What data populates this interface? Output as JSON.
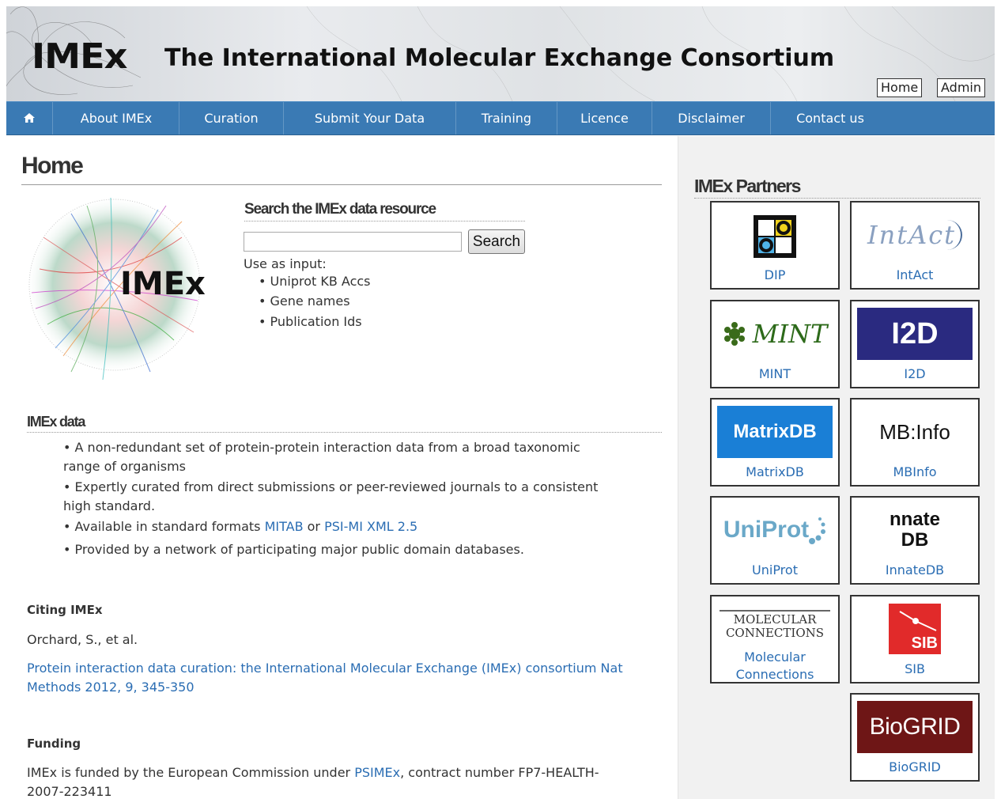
{
  "header": {
    "logo_text": "IMEx",
    "title": "The International Molecular Exchange Consortium",
    "home_button": "Home",
    "admin_button": "Admin"
  },
  "nav": {
    "home_icon": "home-icon",
    "items": [
      "About IMEx",
      "Curation",
      "Submit Your Data",
      "Training",
      "Licence",
      "Disclaimer",
      "Contact us"
    ]
  },
  "main": {
    "page_title": "Home",
    "hero_logo_text": "IMEx",
    "search": {
      "title": "Search the IMEx data resource",
      "placeholder": "",
      "button": "Search",
      "use_as": "Use as input:",
      "inputs": [
        "• Uniprot KB Accs",
        "• Gene names",
        "• Publication Ids"
      ]
    },
    "imex_data": {
      "heading": "IMEx data",
      "bullet1": "• A non-redundant set of protein-protein interaction data from a broad taxonomic range of organisms",
      "bullet2": "• Expertly curated from direct submissions or peer-reviewed journals to a consistent high standard.",
      "bullet3_prefix": "• Available in standard formats ",
      "bullet3_link1": "MITAB",
      "bullet3_mid": " or ",
      "bullet3_link2": "PSI-MI XML 2.5",
      "bullet4": "• Provided by a network of participating major public domain databases."
    },
    "citing": {
      "heading": "Citing IMEx",
      "authors": "Orchard, S., et al.",
      "link": "Protein interaction data curation: the International Molecular Exchange (IMEx) consortium Nat Methods 2012, 9, 345-350"
    },
    "funding": {
      "heading": "Funding",
      "text_prefix": "IMEx is funded by the European Commission under ",
      "link": "PSIMEx",
      "text_suffix": ", contract number FP7-HEALTH-2007-223411"
    }
  },
  "sidebar": {
    "title": "IMEx Partners",
    "partners": [
      {
        "label": "DIP"
      },
      {
        "label": "IntAct",
        "logo_text": "IntAct"
      },
      {
        "label": "MINT",
        "logo_text": "MINT"
      },
      {
        "label": "I2D",
        "logo_text": "I2D"
      },
      {
        "label": "MatrixDB",
        "logo_text": "MatrixDB"
      },
      {
        "label": "MBInfo",
        "logo_text": "MB:Info"
      },
      {
        "label": "UniProt",
        "logo_text": "UniProt"
      },
      {
        "label": "InnateDB",
        "logo_text": "nnate DB"
      },
      {
        "label": "Molecular Connections",
        "logo_text": "MOLECULAR CONNECTIONS"
      },
      {
        "label": "SIB",
        "logo_text": "SIB"
      },
      {
        "label": "BioGRID",
        "logo_text": "BioGRID"
      }
    ]
  },
  "colors": {
    "nav_bg": "#3a7ab4",
    "link": "#2a6db3",
    "sidebar_bg": "#f1f1f1"
  }
}
